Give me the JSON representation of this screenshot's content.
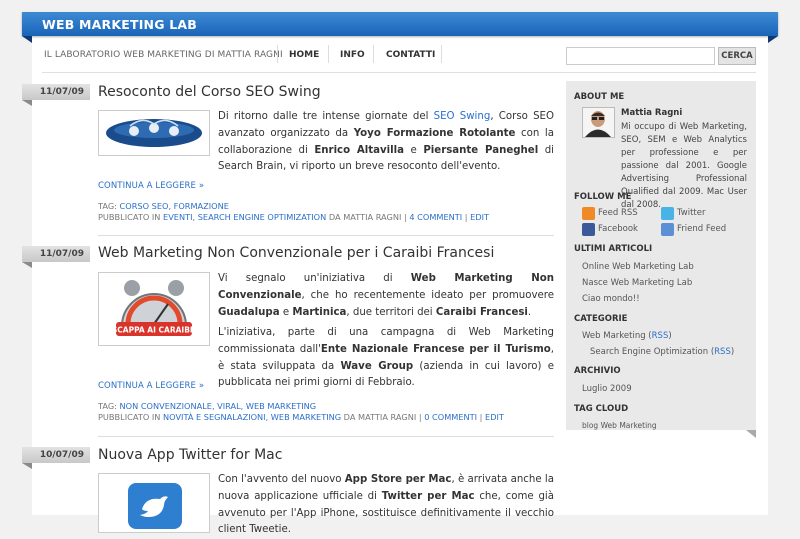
{
  "site": {
    "title": "WEB MARKETING LAB"
  },
  "nav": {
    "tagline": "IL LABORATORIO WEB MARKETING DI MATTIA RAGNI",
    "home": "HOME",
    "info": "INFO",
    "contatti": "CONTATTI"
  },
  "search": {
    "placeholder": "",
    "button": "CERCA"
  },
  "posts": [
    {
      "date": "11/07/09",
      "title": "Resoconto del Corso SEO Swing",
      "p1_a": "Di ritorno dalle tre intense giornate del ",
      "p1_link": "SEO Swing",
      "p1_b": ", Corso SEO avanzato organizzato da ",
      "p1_c": "Yoyo Formazione Rotolante",
      "p1_d": " con la collaborazione di ",
      "p1_e": "Enrico Altavilla",
      "p1_f": " e ",
      "p1_g": "Piersante Paneghel",
      "p1_h": " di Search Brain, vi riporto un breve resoconto dell'evento.",
      "more": "CONTINUA A LEGGERE »",
      "tag_label": "TAG: ",
      "tags": "CORSO SEO, FORMAZIONE",
      "pub_label": "PUBBLICATO IN ",
      "cats": "EVENTI, SEARCH ENGINE OPTIMIZATION",
      "author": " DA MATTIA RAGNI | ",
      "comments": "4 COMMENTI",
      "sep": " | ",
      "edit": "EDIT"
    },
    {
      "date": "11/07/09",
      "title": "Web Marketing Non Convenzionale per i Caraibi Francesi",
      "thumb_label": "SCAPPA AI CARAIBI!",
      "p1_a": "Vi segnalo un'iniziativa di ",
      "p1_b": "Web Marketing Non Convenzionale",
      "p1_c": ", che ho recentemente ideato per promuovere ",
      "p1_d": "Guadalupa",
      "p1_e": " e ",
      "p1_f": "Martinica",
      "p1_g": ", due territori dei ",
      "p1_h": "Caraibi Francesi",
      "p1_i": ".",
      "p2_a": "L'iniziativa, parte di una campagna di Web Marketing commissionata dall'",
      "p2_b": "Ente Nazionale Francese per il Turismo",
      "p2_c": ", è stata sviluppata da ",
      "p2_d": "Wave Group",
      "p2_e": " (azienda in cui lavoro) e pubblicata nei primi giorni di Febbraio.",
      "more": "CONTINUA A LEGGERE »",
      "tag_label": "TAG: ",
      "tags": "NON CONVENZIONALE, VIRAL, WEB MARKETING",
      "pub_label": "PUBBLICATO IN ",
      "cats": "NOVITÀ E SEGNALAZIONI, WEB MARKETING",
      "author": " DA MATTIA RAGNI | ",
      "comments": "0 COMMENTI",
      "sep": " | ",
      "edit": "EDIT"
    },
    {
      "date": "10/07/09",
      "title": "Nuova App Twitter for Mac",
      "p1_a": "Con l'avvento del nuovo ",
      "p1_b": "App Store per Mac",
      "p1_c": ", è arrivata anche la nuova applicazione ufficiale di ",
      "p1_d": "Twitter per Mac",
      "p1_e": " che, come già avvenuto per l'App iPhone, sostituisce definitivamente il vecchio client Tweetie."
    }
  ],
  "sidebar": {
    "about_head": "ABOUT ME",
    "about_name": "Mattia Ragni",
    "about_text": "Mi occupo di Web Marketing, SEO, SEM e Web Analytics per professione e per passione dal 2001. Google Advertising Professional Qualified dal 2009. Mac User dal 2008.",
    "follow_head": "FOLLOW ME",
    "feed_rss": "Feed RSS",
    "twitter": "Twitter",
    "facebook": "Facebook",
    "friend_feed": "Friend Feed",
    "recent_head": "ULTIMI ARTICOLI",
    "recent": [
      "Online Web Marketing Lab",
      "Nasce Web Marketing Lab",
      "Ciao mondo!!"
    ],
    "cat_head": "CATEGORIE",
    "cat1": "Web Marketing",
    "cat2": "Search Engine Optimization",
    "rss_open": " (",
    "rss": "RSS",
    "rss_close": ")",
    "archive_head": "ARCHIVIO",
    "archive1": "Luglio 2009",
    "tagcloud_head": "TAG CLOUD",
    "tagcloud": "blog Web Marketing"
  },
  "colors": {
    "accent": "#1a64b8",
    "link": "#2a6fc9"
  }
}
